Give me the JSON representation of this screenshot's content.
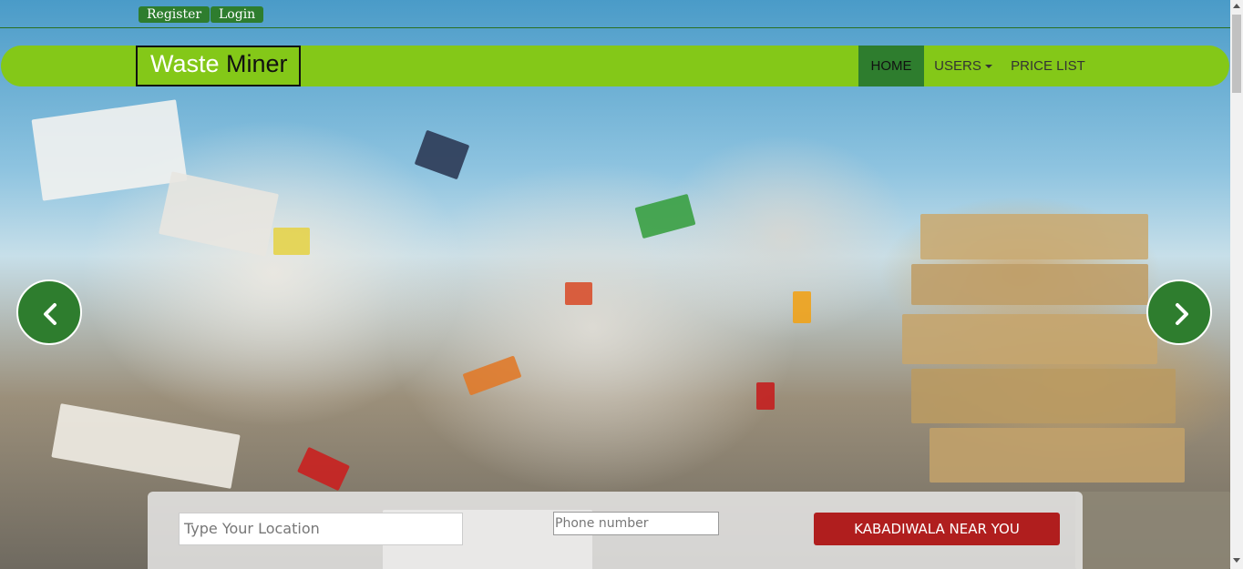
{
  "topbar": {
    "register_label": "Register",
    "login_label": "Login"
  },
  "brand": {
    "part1": "Waste",
    "part2": "Miner"
  },
  "nav": {
    "items": [
      {
        "label": "HOME",
        "active": true
      },
      {
        "label": "USERS",
        "has_dropdown": true
      },
      {
        "label": "PRICE LIST"
      }
    ]
  },
  "carousel": {
    "prev_icon": "chevron-left-icon",
    "next_icon": "chevron-right-icon"
  },
  "search": {
    "location_placeholder": "Type Your Location",
    "phone_placeholder": "Phone number",
    "submit_label": "KABADIWALA NEAR YOU"
  },
  "colors": {
    "nav_green": "#84c818",
    "dark_green": "#2e7d2e",
    "button_red": "#b01e1e"
  }
}
